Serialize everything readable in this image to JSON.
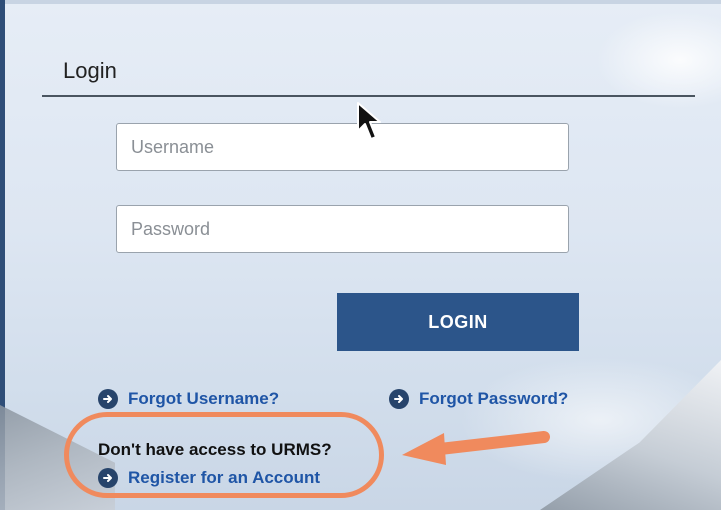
{
  "login": {
    "title": "Login",
    "username_placeholder": "Username",
    "password_placeholder": "Password",
    "login_button": "LOGIN"
  },
  "links": {
    "forgot_username": "Forgot Username?",
    "forgot_password": "Forgot Password?",
    "no_access_text": "Don't have access to URMS?",
    "register": "Register for an Account"
  },
  "icons": {
    "link_icon": "arrow-circle-right-icon",
    "cursor": "mouse-pointer-icon",
    "callout": "callout-arrow-icon"
  },
  "colors": {
    "primary": "#2c558a",
    "link": "#1f55a6",
    "annotation": "#f08a5d"
  }
}
